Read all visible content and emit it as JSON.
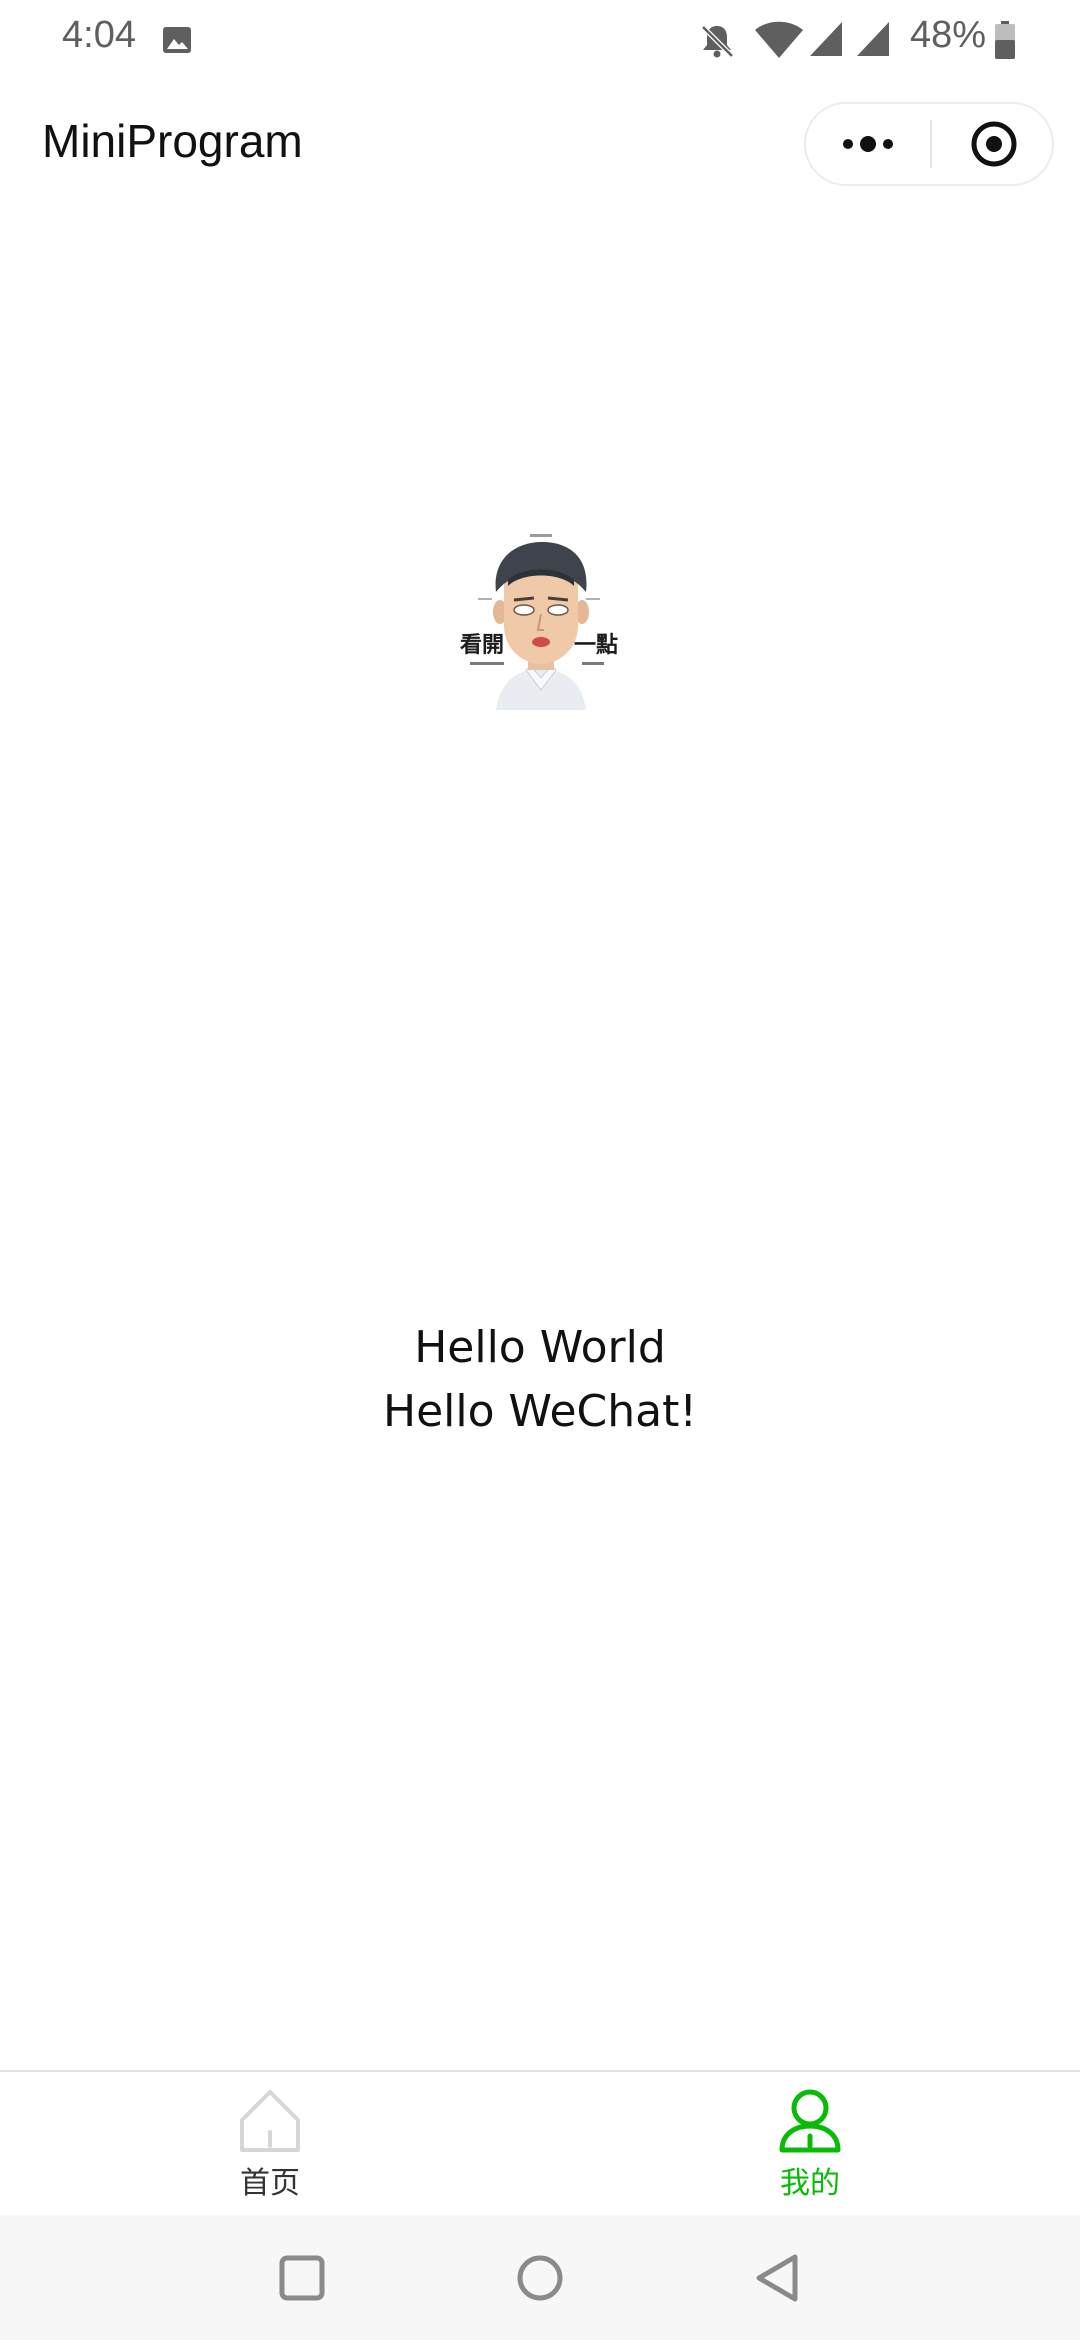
{
  "status_bar": {
    "time": "4:04",
    "battery_percent": "48%",
    "icons": [
      "image-icon",
      "bell-off-icon",
      "wifi-icon",
      "signal-icon",
      "signal-icon",
      "battery-icon"
    ]
  },
  "title_bar": {
    "title": "MiniProgram",
    "more_icon": "more-dots-icon",
    "close_icon": "target-close-icon"
  },
  "main": {
    "avatar_icon": "avatar-image",
    "avatar_caption_left": "看開",
    "avatar_caption_right": "一點",
    "line1": "Hello World",
    "line2": "Hello WeChat!"
  },
  "tab_bar": {
    "tabs": [
      {
        "label": "首页",
        "icon": "home-icon",
        "active": false
      },
      {
        "label": "我的",
        "icon": "user-icon",
        "active": true
      }
    ],
    "active_color": "#09bb07",
    "inactive_color": "#333333"
  },
  "nav_bar": {
    "buttons": [
      "recents-square-icon",
      "home-circle-icon",
      "back-triangle-icon"
    ]
  }
}
